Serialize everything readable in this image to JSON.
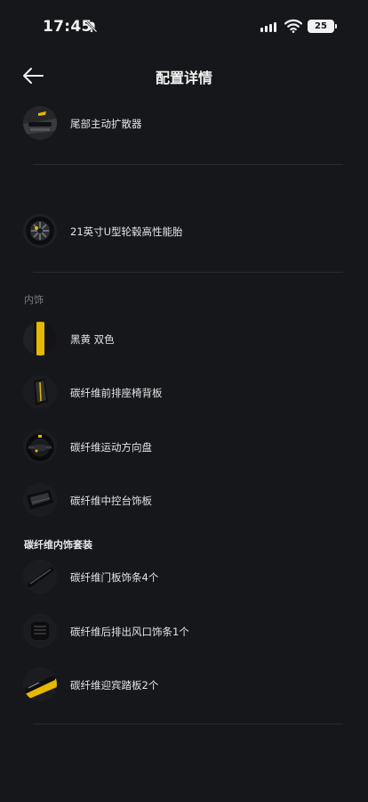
{
  "status_bar": {
    "time": "17:45",
    "battery": "25"
  },
  "header": {
    "title": "配置详情"
  },
  "exterior_items": [
    {
      "label": "尾部主动扩散器"
    },
    {
      "label": "21英寸U型轮毂高性能胎"
    }
  ],
  "interior": {
    "title": "内饰",
    "items": [
      {
        "label": "黑黄 双色"
      },
      {
        "label": "碳纤维前排座椅背板"
      },
      {
        "label": "碳纤维运动方向盘"
      },
      {
        "label": "碳纤维中控台饰板"
      }
    ]
  },
  "interior_kit": {
    "title": "碳纤维内饰套装",
    "items": [
      {
        "label": "碳纤维门板饰条4个"
      },
      {
        "label": "碳纤维后排出风口饰条1个"
      },
      {
        "label": "碳纤维迎宾踏板2个"
      }
    ]
  },
  "colors": {
    "background": "#16171b",
    "accent": "#e6b800"
  }
}
